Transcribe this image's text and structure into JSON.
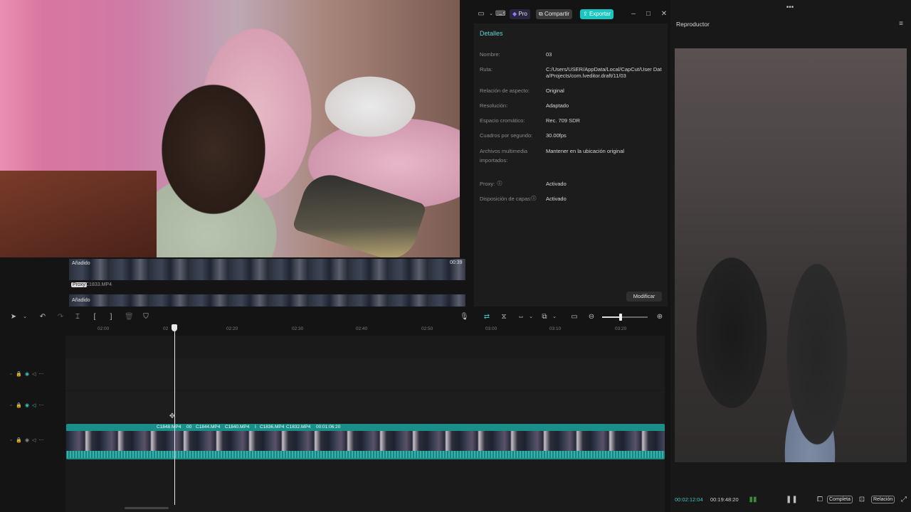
{
  "topbar": {
    "pro_label": "Pro",
    "share_label": "Compartir",
    "export_label": "Exportar",
    "accent": "#19c6c0"
  },
  "details": {
    "title": "Detalles",
    "rows": [
      {
        "label": "Nombre:",
        "value": "03"
      },
      {
        "label": "Ruta:",
        "value": "C:/Users/USER/AppData/Local/CapCut/User Data/Projects/com.lveditor.draft/11/03"
      },
      {
        "label": "Relación de aspecto:",
        "value": "Original"
      },
      {
        "label": "Resolución:",
        "value": "Adaptado"
      },
      {
        "label": "Espacio cromático:",
        "value": "Rec. 709 SDR"
      },
      {
        "label": "Cuadros por segundo:",
        "value": "30.00fps"
      },
      {
        "label": "Archivos multimedia importados:",
        "value": "Mantener en la ubicación original"
      },
      {
        "label": "Proxy:",
        "value": "Activado"
      },
      {
        "label": "Disposición de capas:",
        "value": "Activado"
      }
    ],
    "modify_label": "Modificar"
  },
  "media": {
    "strip1_badge": "Añadido",
    "strip1_duration": "00:39",
    "proxy_badge": "Proxy",
    "file_name": "C1833.MP4",
    "strip2_badge": "Añadido"
  },
  "player": {
    "title": "Reproductor",
    "current_time": "00:02:12:04",
    "total_time": "00:19:48:20",
    "complete_label": "Completa",
    "ratio_label": "Relación"
  },
  "timeline": {
    "ruler_ticks": [
      "02:00",
      "02",
      "02:20",
      "02:30",
      "02:40",
      "02:50",
      "03:00",
      "03:10",
      "03:20"
    ],
    "clip_labels": [
      "C1848.MP4",
      "00",
      "C1844.MP4",
      "C1840.MP4",
      "I",
      "C1836.MP4",
      "C1832.MP4",
      "00:01:06:20"
    ]
  }
}
